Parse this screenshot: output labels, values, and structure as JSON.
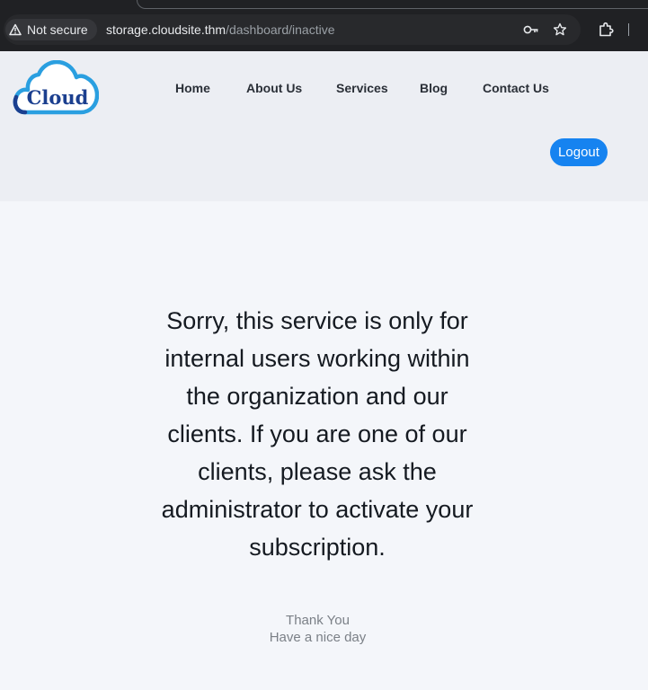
{
  "browser": {
    "security_label": "Not secure",
    "url_host": "storage.cloudsite.thm",
    "url_path": "/dashboard/inactive",
    "icons": [
      "warning-icon",
      "key-icon",
      "star-icon",
      "extensions-icon"
    ]
  },
  "site": {
    "logo_text": "Cloud",
    "nav": {
      "home": "Home",
      "about": "About Us",
      "services": "Services",
      "blog": "Blog",
      "contact": "Contact Us"
    },
    "logout_label": "Logout"
  },
  "main": {
    "message": "Sorry, this service is only for internal users working within the organization and our clients. If you are one of our clients, please ask the administrator to activate your subscription.",
    "thanks_line1": "Thank You",
    "thanks_line2": "Have a nice day"
  },
  "colors": {
    "accent": "#1683f0",
    "logo_blue": "#2a9fe0",
    "logo_text": "#1b3f8f"
  }
}
